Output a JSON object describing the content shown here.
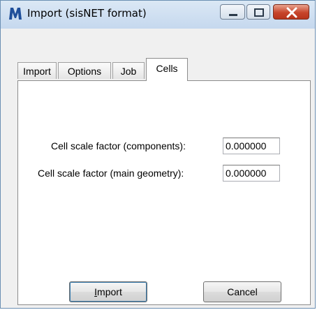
{
  "window": {
    "title": "Import (sisNET format)",
    "icon": "microstation-icon"
  },
  "caption_buttons": {
    "minimize": "minimize-icon",
    "maximize": "maximize-icon",
    "close": "close-icon"
  },
  "tabs": [
    {
      "label": "Import",
      "selected": false
    },
    {
      "label": "Options",
      "selected": false
    },
    {
      "label": "Job",
      "selected": false
    },
    {
      "label": "Cells",
      "selected": true
    }
  ],
  "cells_panel": {
    "rows": [
      {
        "label": "Cell scale factor (components):",
        "value": "0.000000"
      },
      {
        "label": "Cell scale factor (main geometry):",
        "value": "0.000000"
      }
    ]
  },
  "buttons": {
    "import_prefix": "",
    "import_mnemonic": "I",
    "import_rest": "mport",
    "cancel": "Cancel"
  },
  "colors": {
    "titlebar": "#c5d8ee",
    "close_button": "#c7452b",
    "panel_background": "#ffffff"
  }
}
